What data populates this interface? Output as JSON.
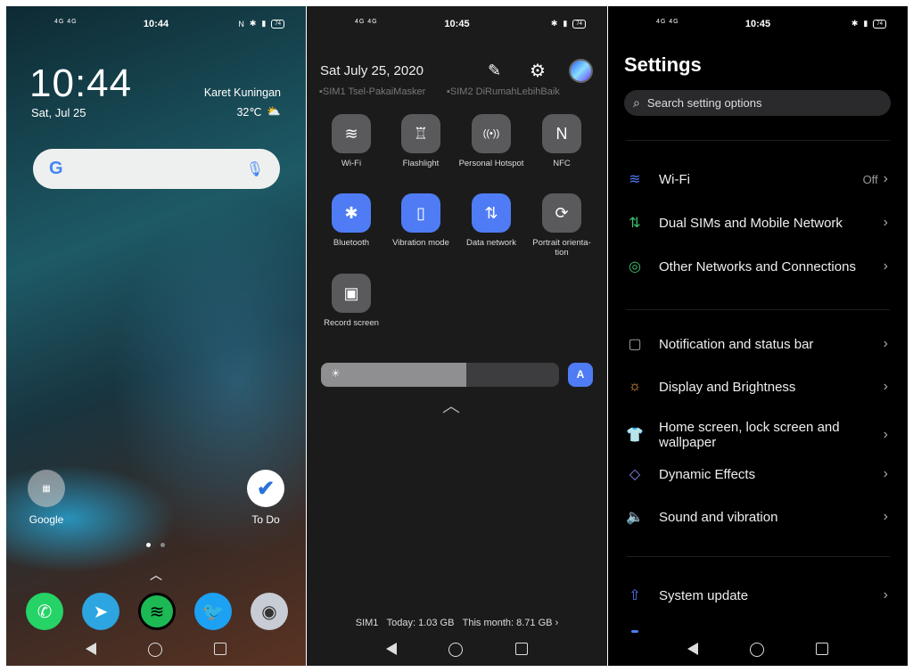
{
  "home": {
    "status": {
      "time": "10:44",
      "left": "4G 4G",
      "battery": "74"
    },
    "clock": "10:44",
    "date": "Sat, Jul 25",
    "location": "Karet Kuningan",
    "temperature": "32℃",
    "folder_label": "Google",
    "todo_label": "To Do",
    "dock": [
      {
        "icon": "whatsapp-icon",
        "color": "#25d366"
      },
      {
        "icon": "telegram-icon",
        "color": "#2ca5e0"
      },
      {
        "icon": "spotify-icon",
        "color": "#1db954"
      },
      {
        "icon": "twitter-icon",
        "color": "#1da1f2"
      },
      {
        "icon": "camera-icon",
        "color": "#c8ccd4"
      }
    ]
  },
  "shade": {
    "status": {
      "time": "10:45",
      "left": "4G 4G",
      "battery": "74"
    },
    "date": "Sat July 25, 2020",
    "sim1": "SIM1 Tsel-PakaiMasker",
    "sim2": "SIM2 DiRumahLebihBaik",
    "tiles": [
      {
        "label": "Wi-Fi",
        "icon": "wifi-icon",
        "on": false
      },
      {
        "label": "Flashlight",
        "icon": "flashlight-icon",
        "on": false
      },
      {
        "label": "Personal Hotspot",
        "icon": "hotspot-icon",
        "on": false
      },
      {
        "label": "NFC",
        "icon": "nfc-icon",
        "on": false
      },
      {
        "label": "Bluetooth",
        "icon": "bluetooth-icon",
        "on": true
      },
      {
        "label": "Vibration mode",
        "icon": "vibration-icon",
        "on": true
      },
      {
        "label": "Data network",
        "icon": "data-network-icon",
        "on": true
      },
      {
        "label": "Portrait orienta-tion",
        "icon": "rotation-lock-icon",
        "on": false
      },
      {
        "label": "Record screen",
        "icon": "record-screen-icon",
        "on": false
      }
    ],
    "brightness_percent": 61,
    "auto_label": "A",
    "usage": {
      "sim": "SIM1",
      "today": "Today: 1.03 GB",
      "month": "This month: 8.71 GB"
    },
    "accent": "#4f7cf5"
  },
  "settings": {
    "status": {
      "time": "10:45",
      "left": "4G 4G",
      "battery": "74"
    },
    "title": "Settings",
    "search_placeholder": "Search setting options",
    "items": [
      {
        "label": "Wi-Fi",
        "value": "Off",
        "icon": "wifi-icon",
        "color": "#4f7cf5"
      },
      {
        "label": "Dual SIMs and Mobile Network",
        "icon": "dual-sim-icon",
        "color": "#3fbf6f"
      },
      {
        "label": "Other Networks and Connections",
        "icon": "connections-icon",
        "color": "#3fbf6f"
      },
      {
        "label": "Notification and status bar",
        "icon": "notification-icon",
        "color": "#aaaaaa"
      },
      {
        "label": "Display and Brightness",
        "icon": "brightness-icon",
        "color": "#f0a040"
      },
      {
        "label": "Home screen, lock screen and wallpaper",
        "icon": "shirt-icon",
        "color": "#6a6ff0"
      },
      {
        "label": "Dynamic Effects",
        "icon": "dynamic-effects-icon",
        "color": "#8a8ff0"
      },
      {
        "label": "Sound and vibration",
        "icon": "speaker-icon",
        "color": "#f06a50"
      },
      {
        "label": "System update",
        "icon": "update-arrow-icon",
        "color": "#4f7cf5"
      }
    ]
  }
}
